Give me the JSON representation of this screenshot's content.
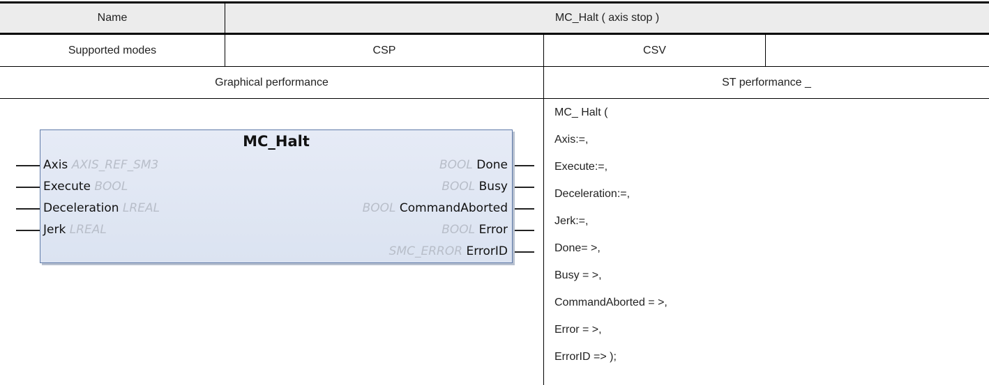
{
  "header": {
    "name_label": "Name",
    "name_value": "MC_Halt ( axis stop )"
  },
  "modes": {
    "label": "Supported modes",
    "csp": "CSP",
    "csv": "CSV",
    "extra": ""
  },
  "sections": {
    "graphical": "Graphical performance",
    "st": "ST performance _"
  },
  "block": {
    "title": "MC_Halt",
    "inputs": [
      {
        "name": "Axis",
        "type": "AXIS_REF_SM3"
      },
      {
        "name": "Execute",
        "type": "BOOL"
      },
      {
        "name": "Deceleration",
        "type": "LREAL"
      },
      {
        "name": "Jerk",
        "type": "LREAL"
      }
    ],
    "outputs": [
      {
        "type": "BOOL",
        "name": "Done"
      },
      {
        "type": "BOOL",
        "name": "Busy"
      },
      {
        "type": "BOOL",
        "name": "CommandAborted"
      },
      {
        "type": "BOOL",
        "name": "Error"
      },
      {
        "type": "SMC_ERROR",
        "name": "ErrorID"
      }
    ]
  },
  "st_code": [
    "MC_ Halt (",
    "Axis:=,",
    "Execute:=,",
    "Deceleration:=,",
    "Jerk:=,",
    "Done= >,",
    "Busy = >,",
    "CommandAborted = >,",
    "Error = >,",
    "ErrorID => );"
  ]
}
